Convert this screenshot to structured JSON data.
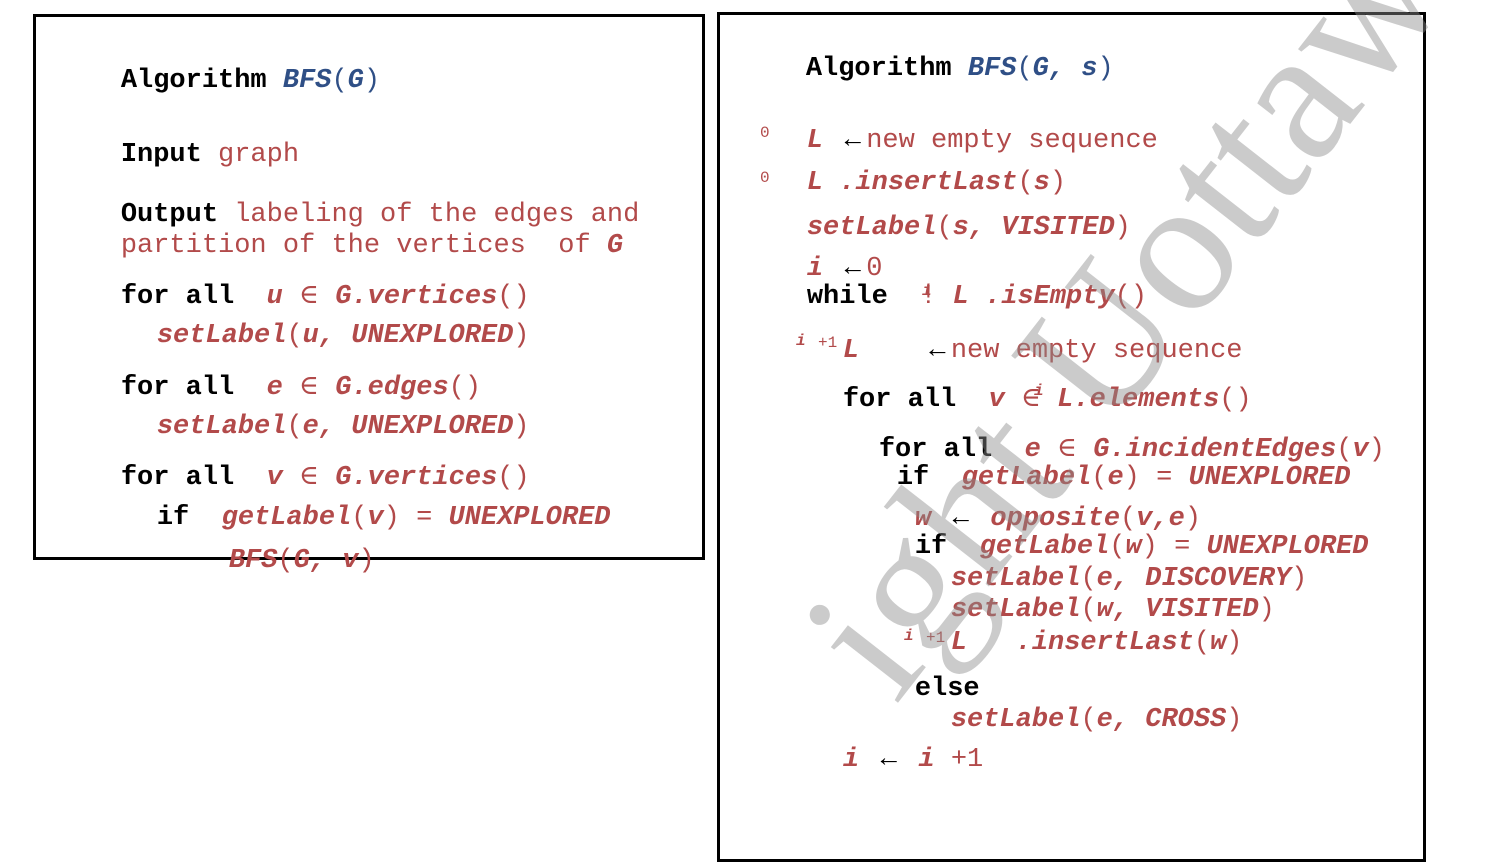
{
  "left": {
    "kw_algorithm": "Algorithm",
    "name": "BFS",
    "param": "G",
    "kw_input": "Input",
    "input_text": "graph",
    "kw_output": "Output",
    "output_line1": "labeling of the edges and",
    "output_line2": "partition of the vertices  of",
    "output_g": "G",
    "kw_forall": "for all",
    "kw_if": "if",
    "var_u": "u",
    "var_e": "e",
    "var_v": "v",
    "elem": "∈",
    "g_vertices": "G.vertices",
    "g_edges": "G.edges",
    "set_label": "setLabel",
    "unexplored": "UNEXPLORED",
    "get_label": "getLabel",
    "eq": "=",
    "bfs_call": "BFS",
    "bfs_args": "G, v"
  },
  "right": {
    "kw_algorithm": "Algorithm",
    "name": "BFS",
    "params": "G, s",
    "L": "L",
    "sub_0": "0",
    "sub_i": "i",
    "sub_i1": "+1",
    "arrow": "←",
    "new_empty_sequence": "new empty sequence",
    "insert_last": ".insertLast",
    "var_s": "s",
    "set_label": "setLabel",
    "visited": "VISITED",
    "var_i": "i",
    "zero": "0",
    "kw_while": "while",
    "not": "!",
    "is_empty": ".isEmpty",
    "kw_forall": "for all",
    "var_v": "v",
    "elem": "∈",
    "elements": ".elements",
    "var_e": "e",
    "incident_edges": "G.incidentEdges",
    "kw_if": "if",
    "get_label": "getLabel",
    "eq": "=",
    "unexplored": "UNEXPLORED",
    "var_w": "w",
    "opposite": "opposite",
    "opposite_args": "v,e",
    "discovery_args": "e, DISCOVERY",
    "visited_args": "w, VISITED",
    "kw_else": "else",
    "cross_args": "e, CROSS",
    "plus_one": "+1"
  },
  "watermark": {
    "text": "ight Uottawa"
  }
}
